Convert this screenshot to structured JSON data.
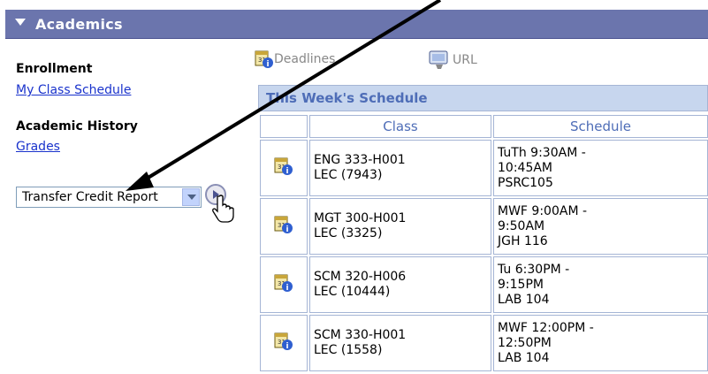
{
  "header": {
    "title": "Academics"
  },
  "enrollment": {
    "label": "Enrollment",
    "link": "My Class Schedule"
  },
  "history": {
    "label": "Academic History",
    "link": "Grades"
  },
  "dropdown": {
    "selected": "Transfer Credit Report"
  },
  "tools": {
    "deadlines": "Deadlines",
    "url": "URL"
  },
  "schedule": {
    "title": "This Week's Schedule",
    "columns": [
      "Class",
      "Schedule"
    ],
    "rows": [
      {
        "class_line1": "ENG 333-H001",
        "class_line2": "LEC (7943)",
        "sched_line1": "TuTh 9:30AM -",
        "sched_line2": "10:45AM",
        "sched_line3": "PSRC105"
      },
      {
        "class_line1": "MGT 300-H001",
        "class_line2": "LEC (3325)",
        "sched_line1": "MWF 9:00AM -",
        "sched_line2": "9:50AM",
        "sched_line3": "JGH 116"
      },
      {
        "class_line1": "SCM 320-H006",
        "class_line2": "LEC (10444)",
        "sched_line1": "Tu 6:30PM -",
        "sched_line2": "9:15PM",
        "sched_line3": "LAB 104"
      },
      {
        "class_line1": "SCM 330-H001",
        "class_line2": "LEC (1558)",
        "sched_line1": "MWF 12:00PM -",
        "sched_line2": "12:50PM",
        "sched_line3": "LAB 104"
      }
    ]
  },
  "colors": {
    "header_bg": "#6b75ad",
    "link": "#1a33cc",
    "table_header_text": "#4e6db7",
    "title_bar_bg": "#c7d6ee"
  }
}
